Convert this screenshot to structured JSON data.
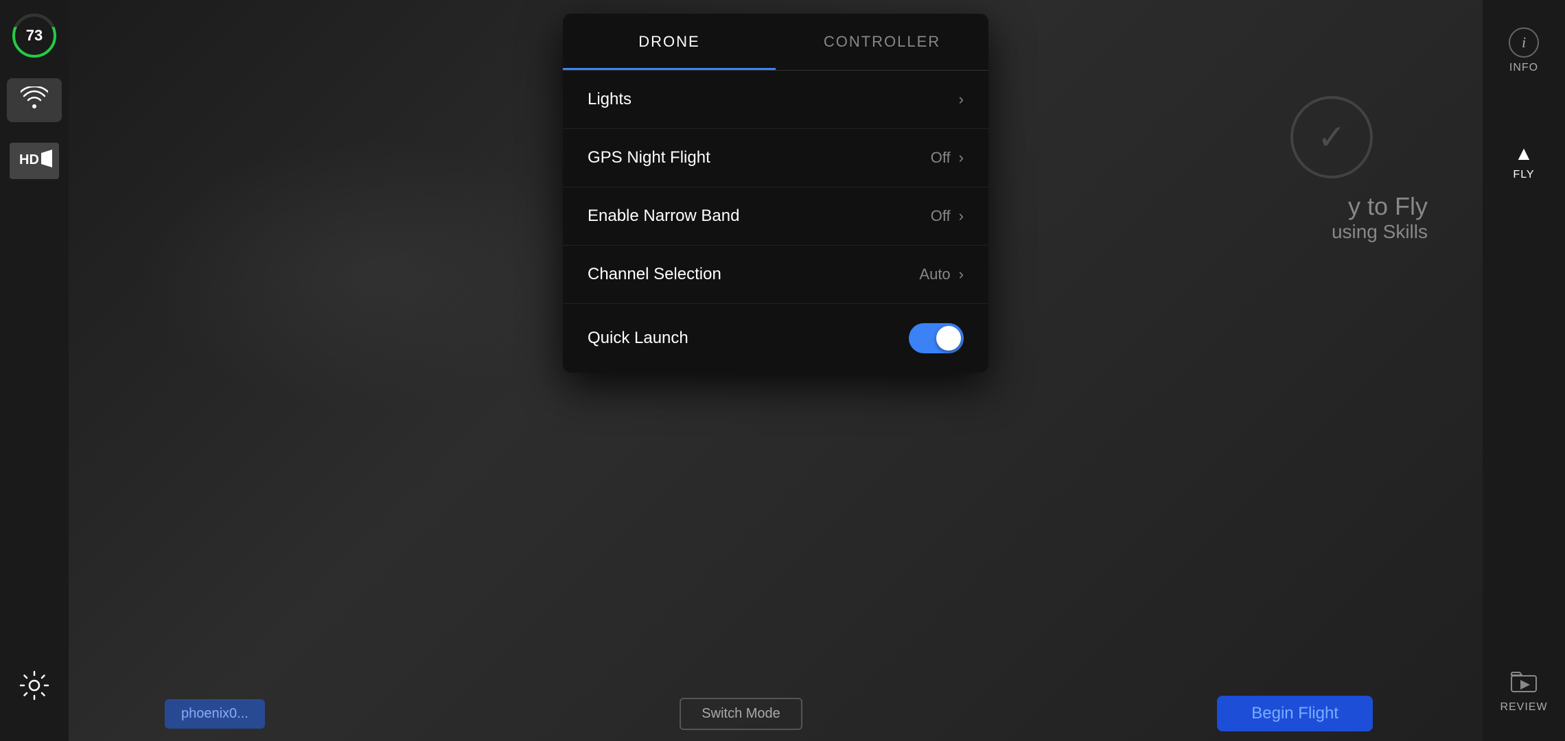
{
  "background": {
    "color": "#2a2a2a"
  },
  "left_sidebar": {
    "battery": {
      "value": "73",
      "color": "#22cc44"
    },
    "wifi_icon": "wifi",
    "hd_icon": "HD",
    "gear_icon": "settings"
  },
  "right_sidebar": {
    "items": [
      {
        "id": "info",
        "label": "INFO",
        "icon": "ⓘ",
        "active": false
      },
      {
        "id": "fly",
        "label": "FLY",
        "icon": "▲",
        "active": true
      },
      {
        "id": "review",
        "label": "REVIEW",
        "icon": "▶",
        "active": false
      }
    ]
  },
  "settings_panel": {
    "tabs": [
      {
        "id": "drone",
        "label": "DRONE",
        "active": true
      },
      {
        "id": "controller",
        "label": "CONTROLLER",
        "active": false
      }
    ],
    "rows": [
      {
        "id": "lights",
        "label": "Lights",
        "value": "",
        "type": "chevron"
      },
      {
        "id": "gps_night_flight",
        "label": "GPS Night Flight",
        "value": "Off",
        "type": "chevron"
      },
      {
        "id": "enable_narrow_band",
        "label": "Enable Narrow Band",
        "value": "Off",
        "type": "chevron"
      },
      {
        "id": "channel_selection",
        "label": "Channel Selection",
        "value": "Auto",
        "type": "chevron"
      },
      {
        "id": "quick_launch",
        "label": "Quick Launch",
        "value": "",
        "type": "toggle",
        "toggle_on": true
      }
    ]
  },
  "bottom_bar": {
    "tag_label": "phoenix0...",
    "switch_mode_label": "Switch Mode",
    "begin_flight_label": "Begin Flight"
  },
  "background_text": {
    "line1": "y to Fly",
    "line2": "using Skills"
  }
}
